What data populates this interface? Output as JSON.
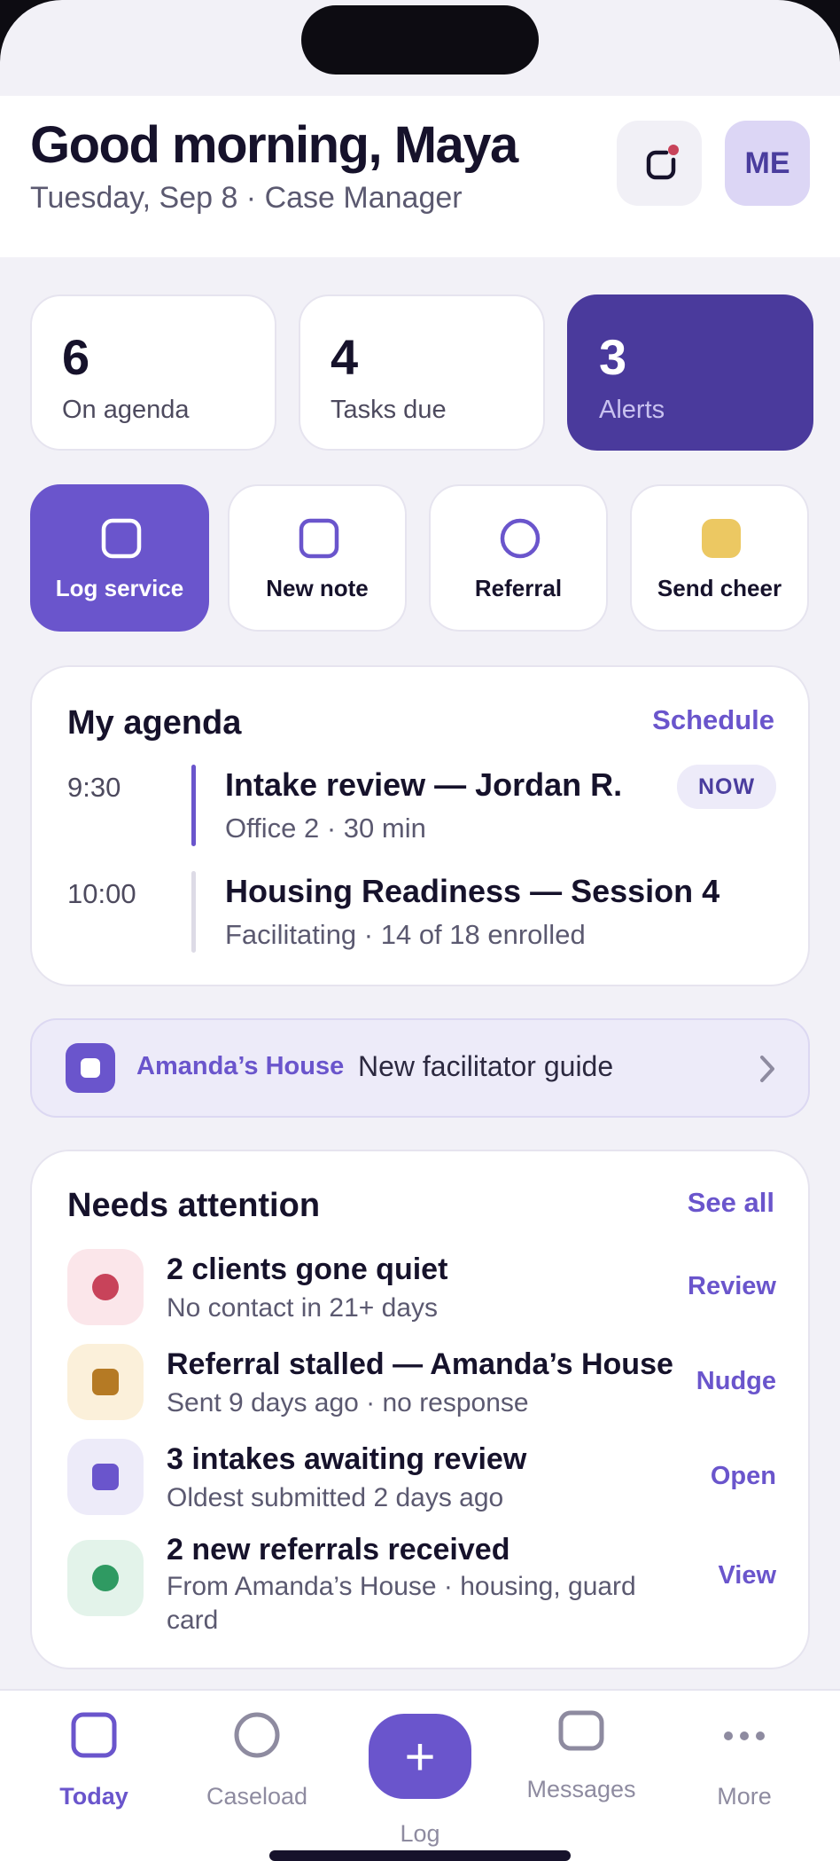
{
  "header": {
    "greeting": "Good morning, Maya",
    "subline": "Tuesday, Sep 8 · Case Manager",
    "avatar_initials": "ME"
  },
  "stats": [
    {
      "value": "6",
      "label": "On agenda"
    },
    {
      "value": "4",
      "label": "Tasks due"
    },
    {
      "value": "3",
      "label": "Alerts"
    }
  ],
  "quick_actions": [
    {
      "label": "Log service",
      "icon": "square-icon"
    },
    {
      "label": "New note",
      "icon": "square-icon"
    },
    {
      "label": "Referral",
      "icon": "circle-icon"
    },
    {
      "label": "Send cheer",
      "icon": "yellow-square-icon"
    }
  ],
  "agenda": {
    "title": "My agenda",
    "link": "Schedule",
    "items": [
      {
        "time": "9:30",
        "title": "Intake review — Jordan R.",
        "sub": "Office 2 · 30 min",
        "badge": "NOW"
      },
      {
        "time": "10:00",
        "title": "Housing Readiness — Session 4",
        "sub": "Facilitating · 14 of 18 enrolled"
      }
    ]
  },
  "banner": {
    "org": "Amanda’s House",
    "text": "New facilitator guide"
  },
  "attention": {
    "title": "Needs attention",
    "link": "See all",
    "items": [
      {
        "title": "2 clients gone quiet",
        "sub": "No contact in 21+ days",
        "action": "Review",
        "color": "#c8435a",
        "bg": "#fbe6ea"
      },
      {
        "title": "Referral stalled — Amanda’s House",
        "sub": "Sent 9 days ago · no response",
        "action": "Nudge",
        "color": "#b57a24",
        "bg": "#fbf0da"
      },
      {
        "title": "3 intakes awaiting review",
        "sub": "Oldest submitted 2 days ago",
        "action": "Open",
        "color": "#6a55cc",
        "bg": "#edebf9"
      },
      {
        "title": "2 new referrals received",
        "sub": "From Amanda’s House · housing, guard card",
        "action": "View",
        "color": "#2f9a62",
        "bg": "#e3f3ea"
      }
    ]
  },
  "tabbar": {
    "today": "Today",
    "caseload": "Caseload",
    "log": "Log",
    "messages": "Messages",
    "more": "More"
  },
  "colors": {
    "accent": "#6a55cc",
    "accent_dark": "#4a3a9c",
    "background": "#f2f1f7"
  }
}
